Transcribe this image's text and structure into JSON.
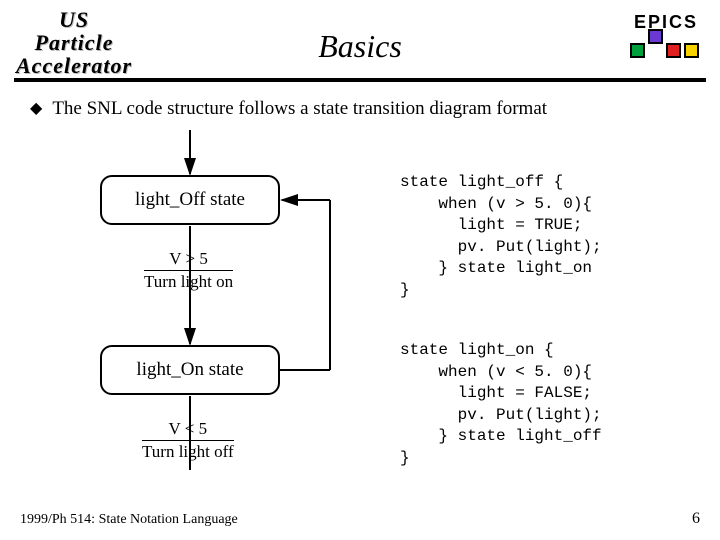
{
  "logo": {
    "line1": "US",
    "line2": "Particle",
    "line3": "Accelerator"
  },
  "epics": {
    "label": "EPICS"
  },
  "title": "Basics",
  "bullet": {
    "text": "The SNL code structure follows a state transition diagram format"
  },
  "diagram": {
    "state_off": "light_Off state",
    "cond_on": "V > 5",
    "action_on": "Turn light on",
    "state_on": "light_On state",
    "cond_off": "V < 5",
    "action_off": "Turn light off"
  },
  "code": {
    "block_off": "state light_off {\n    when (v > 5. 0){\n      light = TRUE;\n      pv. Put(light);\n    } state light_on\n}",
    "block_on": "state light_on {\n    when (v < 5. 0){\n      light = FALSE;\n      pv. Put(light);\n    } state light_off\n}"
  },
  "footer": {
    "left": "1999/Ph 514: State Notation Language",
    "page": "6"
  }
}
